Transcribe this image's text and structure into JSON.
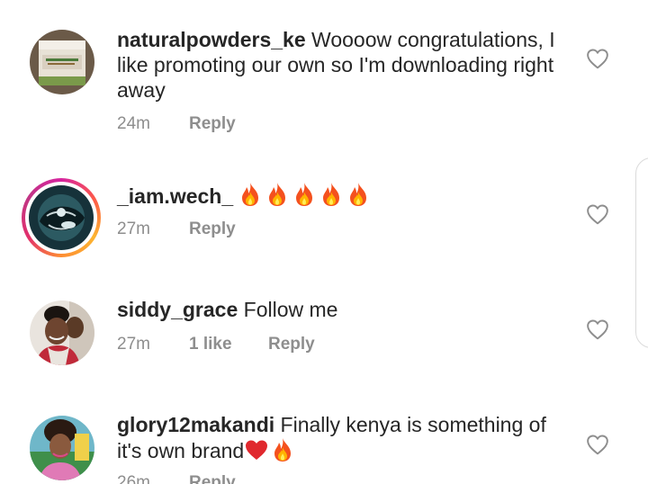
{
  "comments": [
    {
      "username": "naturalpowders_ke",
      "text": "Woooow congratulations, I like promoting our own so I'm downloading right away",
      "time": "24m",
      "likes": "",
      "reply": "Reply"
    },
    {
      "username": "_iam.wech_",
      "text": "",
      "emojis": [
        "fire",
        "fire",
        "fire",
        "fire",
        "fire"
      ],
      "time": "27m",
      "likes": "",
      "reply": "Reply"
    },
    {
      "username": "siddy_grace",
      "text": "Follow me",
      "time": "27m",
      "likes": "1 like",
      "reply": "Reply"
    },
    {
      "username": "glory12makandi",
      "text": "Finally kenya is something of it's own brand",
      "emojis": [
        "red-heart",
        "fire"
      ],
      "time": "26m",
      "likes": "",
      "reply": "Reply"
    }
  ],
  "colors": {
    "text": "#262626",
    "meta": "#8e8e8e",
    "story_ring": "#e1306c",
    "heart_outline": "#8e8e8e"
  },
  "icons": {
    "like": "heart-outline-icon",
    "fire": "fire-emoji",
    "red_heart": "red-heart-emoji"
  }
}
